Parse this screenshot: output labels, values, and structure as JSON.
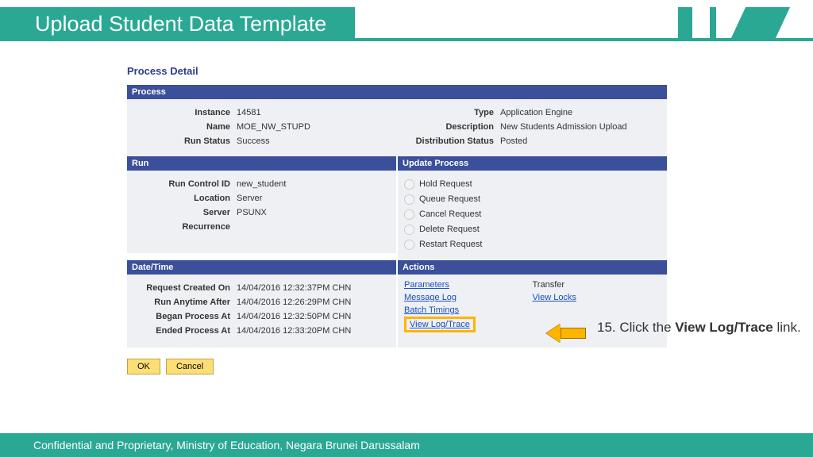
{
  "header": {
    "title": "Upload Student Data Template"
  },
  "pd_title": "Process Detail",
  "process": {
    "head": "Process",
    "instance_l": "Instance",
    "instance_v": "14581",
    "type_l": "Type",
    "type_v": "Application Engine",
    "name_l": "Name",
    "name_v": "MOE_NW_STUPD",
    "desc_l": "Description",
    "desc_v": "New Students Admission Upload",
    "runstat_l": "Run Status",
    "runstat_v": "Success",
    "diststat_l": "Distribution Status",
    "diststat_v": "Posted"
  },
  "run": {
    "head": "Run",
    "rcid_l": "Run Control ID",
    "rcid_v": "new_student",
    "loc_l": "Location",
    "loc_v": "Server",
    "server_l": "Server",
    "server_v": "PSUNX",
    "recur_l": "Recurrence",
    "recur_v": ""
  },
  "update": {
    "head": "Update Process",
    "opts": [
      "Hold Request",
      "Queue Request",
      "Cancel Request",
      "Delete Request",
      "Restart Request"
    ]
  },
  "dt": {
    "head": "Date/Time",
    "created_l": "Request Created On",
    "created_v": "14/04/2016 12:32:37PM CHN",
    "after_l": "Run Anytime After",
    "after_v": "14/04/2016 12:26:29PM CHN",
    "began_l": "Began Process At",
    "began_v": "14/04/2016 12:32:50PM CHN",
    "ended_l": "Ended Process At",
    "ended_v": "14/04/2016 12:33:20PM CHN"
  },
  "actions": {
    "head": "Actions",
    "parameters": "Parameters",
    "transfer": "Transfer",
    "message_log": "Message Log",
    "view_locks": "View Locks",
    "batch": "Batch Timings",
    "viewlog": "View Log/Trace"
  },
  "buttons": {
    "ok": "OK",
    "cancel": "Cancel"
  },
  "callout": {
    "step": "15. Click the ",
    "bold": "View Log/Trace",
    "tail": " link."
  },
  "footer": "Confidential and Proprietary, Ministry of Education, Negara Brunei Darussalam"
}
